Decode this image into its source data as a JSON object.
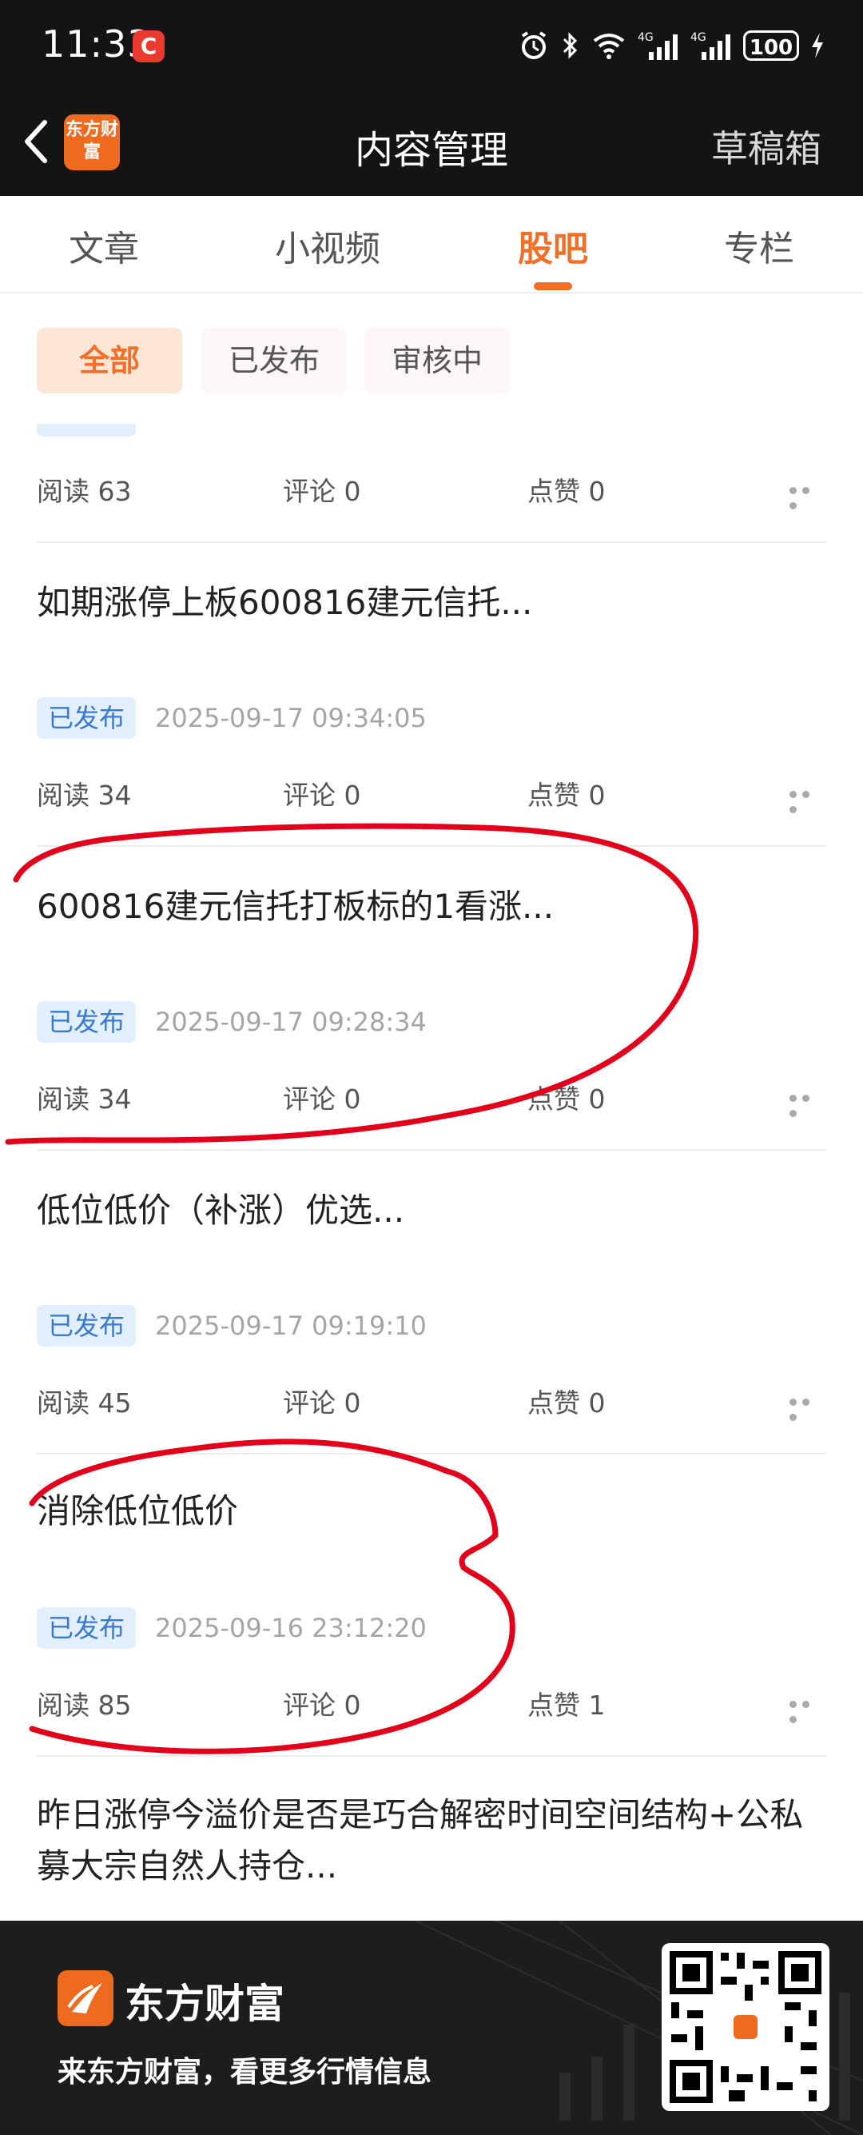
{
  "status": {
    "time": "11:33",
    "app_badge": "C",
    "network1": "4G",
    "network2": "4G",
    "battery": "100"
  },
  "nav": {
    "logo_text": "东方财富",
    "title": "内容管理",
    "drafts": "草稿箱"
  },
  "tabs": [
    {
      "label": "文章"
    },
    {
      "label": "小视频"
    },
    {
      "label": "股吧",
      "active": true
    },
    {
      "label": "专栏"
    }
  ],
  "filters": [
    {
      "label": "全部",
      "active": true
    },
    {
      "label": "已发布"
    },
    {
      "label": "审核中"
    }
  ],
  "partial_post": {
    "read": "阅读 63",
    "comment": "评论 0",
    "like": "点赞 0"
  },
  "posts": [
    {
      "title": "如期涨停上板600816建元信托...",
      "status": "已发布",
      "time": "2025-09-17 09:34:05",
      "read": "阅读 34",
      "comment": "评论 0",
      "like": "点赞 0"
    },
    {
      "title": "600816建元信托打板标的1看涨...",
      "status": "已发布",
      "time": "2025-09-17 09:28:34",
      "read": "阅读 34",
      "comment": "评论 0",
      "like": "点赞 0"
    },
    {
      "title": "低位低价（补涨）优选...",
      "status": "已发布",
      "time": "2025-09-17 09:19:10",
      "read": "阅读 45",
      "comment": "评论 0",
      "like": "点赞 0"
    },
    {
      "title": "消除低位低价",
      "status": "已发布",
      "time": "2025-09-16 23:12:20",
      "read": "阅读 85",
      "comment": "评论 0",
      "like": "点赞 1"
    },
    {
      "title": "昨日涨停今溢价是否是巧合解密时间空间结构+公私募大宗自然人持仓..."
    }
  ],
  "banner": {
    "brand": "东方财富",
    "slogan": "来东方财富，看更多行情信息"
  },
  "colors": {
    "accent": "#f0702a",
    "badge_bg": "#e2efff",
    "badge_text": "#3a78d6",
    "annotation": "#e3001b"
  }
}
